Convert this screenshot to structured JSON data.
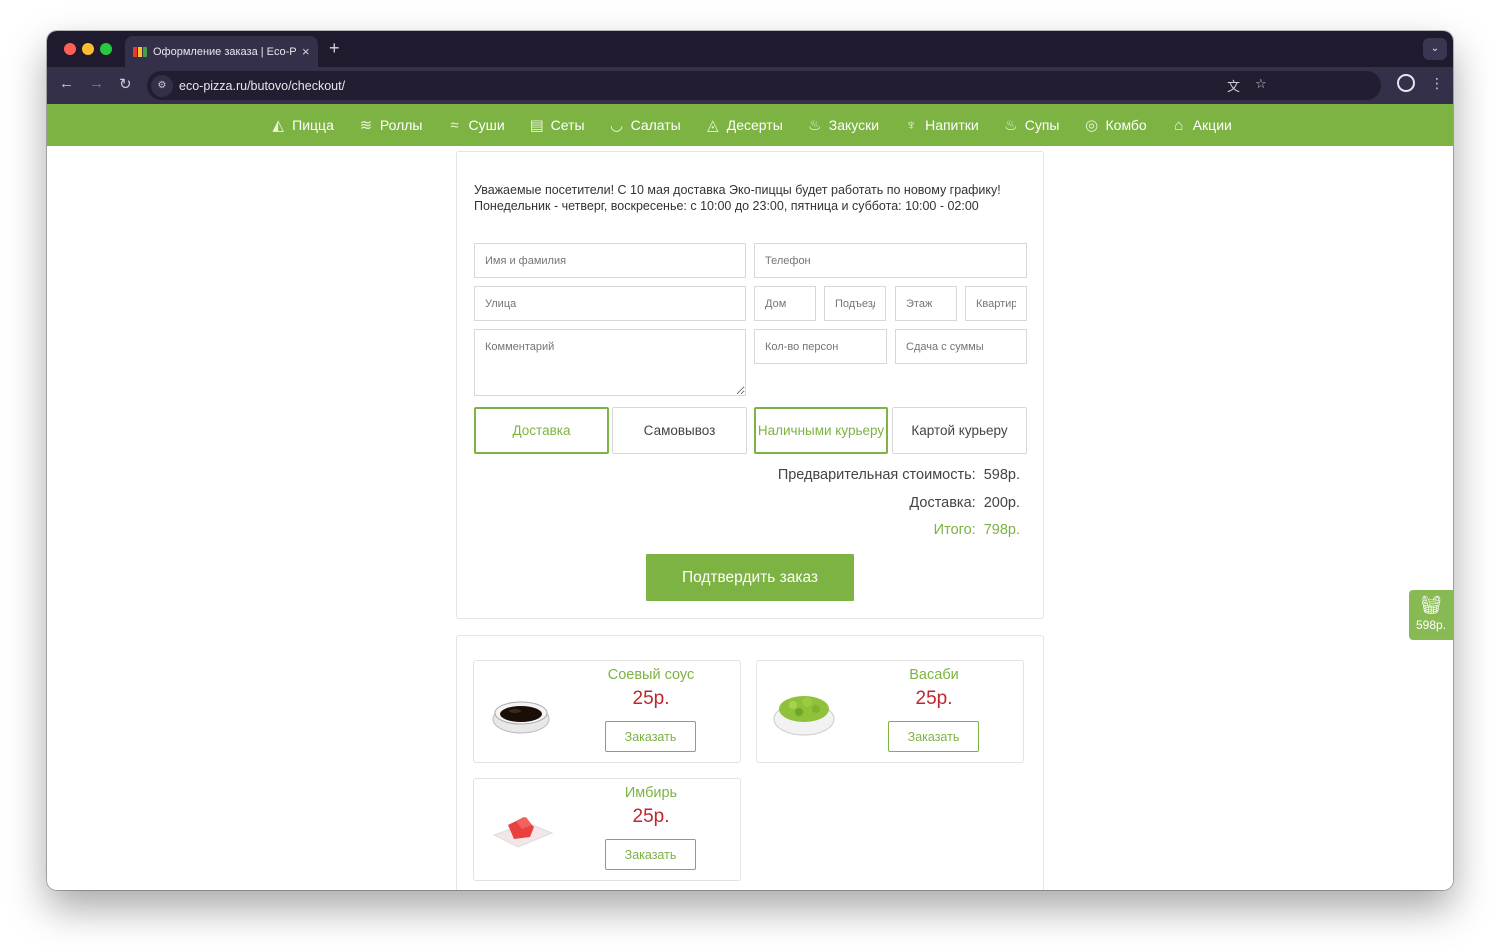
{
  "browser": {
    "tab_title": "Оформление заказа | Eco-P",
    "tab_close": "×",
    "new_tab": "+",
    "url": "eco-pizza.ru/butovo/checkout/"
  },
  "nav": {
    "items": [
      {
        "label": "Пицца",
        "icon": "pizza-icon"
      },
      {
        "label": "Роллы",
        "icon": "rolls-icon"
      },
      {
        "label": "Суши",
        "icon": "sushi-icon"
      },
      {
        "label": "Сеты",
        "icon": "sets-icon"
      },
      {
        "label": "Салаты",
        "icon": "salad-icon"
      },
      {
        "label": "Десерты",
        "icon": "dessert-icon"
      },
      {
        "label": "Закуски",
        "icon": "snacks-icon"
      },
      {
        "label": "Напитки",
        "icon": "drinks-icon"
      },
      {
        "label": "Супы",
        "icon": "soup-icon"
      },
      {
        "label": "Комбо",
        "icon": "combo-icon"
      },
      {
        "label": "Акции",
        "icon": "gift-icon"
      }
    ]
  },
  "order": {
    "notice": "Уважаемые посетители! С 10 мая доставка Эко-пиццы будет работать по новому графику! Понедельник - четверг, воскресенье: с 10:00 до 23:00, пятница и суббота: 10:00 - 02:00",
    "fields": {
      "name": "Имя и фамилия",
      "phone": "Телефон",
      "street": "Улица",
      "house": "Дом",
      "entrance": "Подъезд",
      "floor": "Этаж",
      "apartment": "Квартира",
      "comment": "Комментарий",
      "persons": "Кол-во персон",
      "change": "Сдача с суммы"
    },
    "options": {
      "delivery": "Доставка",
      "pickup": "Самовывоз",
      "cash": "Наличными курьеру",
      "card": "Картой курьеру"
    },
    "summary": {
      "subtotal_label": "Предварительная стоимость:",
      "subtotal_value": "598р.",
      "delivery_label": "Доставка:",
      "delivery_value": "200р.",
      "total_label": "Итого:",
      "total_value": "798р."
    },
    "confirm_label": "Подтвердить заказ"
  },
  "extras": [
    {
      "name": "Соевый соус",
      "price": "25р.",
      "button": "Заказать",
      "image": "soy-sauce-image"
    },
    {
      "name": "Васаби",
      "price": "25р.",
      "button": "Заказать",
      "image": "wasabi-image"
    },
    {
      "name": "Имбирь",
      "price": "25р.",
      "button": "Заказать",
      "image": "ginger-image"
    }
  ],
  "cart": {
    "amount": "598р."
  },
  "colors": {
    "brand_green": "#7cb342",
    "price_red": "#c0272d",
    "browser_dark": "#201a2e"
  }
}
